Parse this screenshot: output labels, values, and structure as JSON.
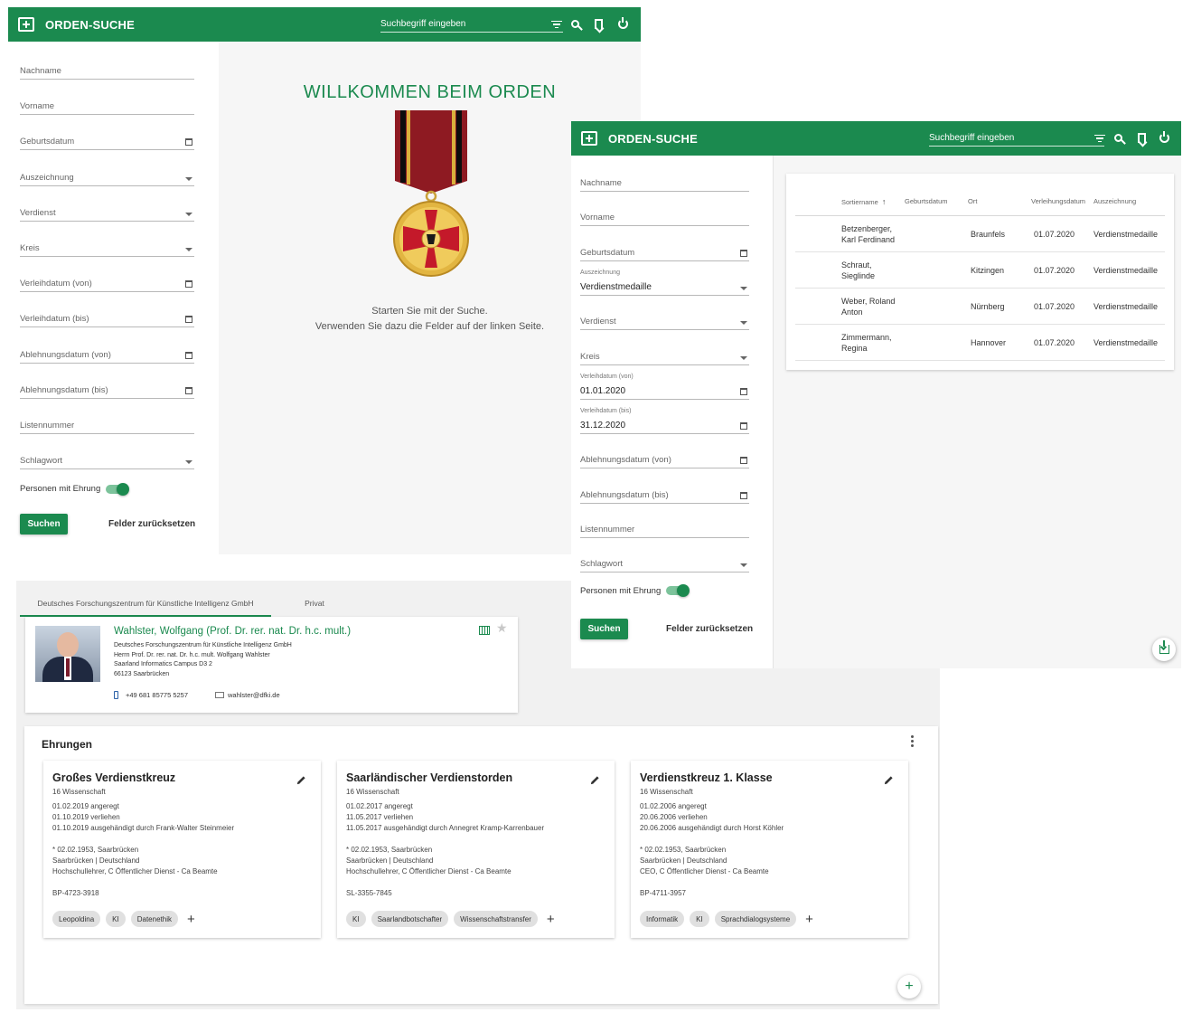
{
  "app": {
    "title": "ORDEN-SUCHE",
    "search_placeholder": "Suchbegriff eingeben"
  },
  "form1": {
    "fields": [
      {
        "label": "Nachname",
        "type": "text"
      },
      {
        "label": "Vorname",
        "type": "text"
      },
      {
        "label": "Geburtsdatum",
        "type": "date"
      },
      {
        "label": "Auszeichnung",
        "type": "select"
      },
      {
        "label": "Verdienst",
        "type": "select"
      },
      {
        "label": "Kreis",
        "type": "select"
      },
      {
        "label": "Verleihdatum (von)",
        "type": "date"
      },
      {
        "label": "Verleihdatum (bis)",
        "type": "date"
      },
      {
        "label": "Ablehnungsdatum (von)",
        "type": "date"
      },
      {
        "label": "Ablehnungsdatum (bis)",
        "type": "date"
      },
      {
        "label": "Listennummer",
        "type": "text"
      },
      {
        "label": "Schlagwort",
        "type": "select"
      }
    ],
    "toggle_label": "Personen mit Ehrung",
    "search_button": "Suchen",
    "reset_button": "Felder zurücksetzen"
  },
  "welcome": {
    "title": "WILLKOMMEN BEIM ORDEN",
    "line1": "Starten Sie mit der Suche.",
    "line2": "Verwenden Sie dazu die Felder auf der linken Seite."
  },
  "form2": {
    "fields": [
      {
        "label": "Nachname",
        "type": "text"
      },
      {
        "label": "Vorname",
        "type": "text"
      },
      {
        "label": "Geburtsdatum",
        "type": "date"
      },
      {
        "label": "Auszeichnung",
        "type": "select",
        "value": "Verdienstmedaille"
      },
      {
        "label": "Verdienst",
        "type": "select"
      },
      {
        "label": "Kreis",
        "type": "select"
      },
      {
        "label": "Verleihdatum (von)",
        "type": "date",
        "value": "01.01.2020"
      },
      {
        "label": "Verleihdatum (bis)",
        "type": "date",
        "value": "31.12.2020"
      },
      {
        "label": "Ablehnungsdatum (von)",
        "type": "date"
      },
      {
        "label": "Ablehnungsdatum (bis)",
        "type": "date"
      },
      {
        "label": "Listennummer",
        "type": "text"
      },
      {
        "label": "Schlagwort",
        "type": "select"
      }
    ],
    "toggle_label": "Personen mit Ehrung",
    "search_button": "Suchen",
    "reset_button": "Felder zurücksetzen"
  },
  "results": {
    "columns": [
      "Sortiername",
      "Geburtsdatum",
      "Ort",
      "Verleihungsdatum",
      "Auszeichnung"
    ],
    "sort_icon": "arrow-up-icon",
    "rows": [
      {
        "name1": "Betzenberger,",
        "name2": "Karl Ferdinand",
        "ort": "Braunfels",
        "datum": "01.07.2020",
        "auszeichnung": "Verdienstmedaille"
      },
      {
        "name1": "Schraut,",
        "name2": "Sieglinde",
        "ort": "Kitzingen",
        "datum": "01.07.2020",
        "auszeichnung": "Verdienstmedaille"
      },
      {
        "name1": "Weber, Roland",
        "name2": "Anton",
        "ort": "Nürnberg",
        "datum": "01.07.2020",
        "auszeichnung": "Verdienstmedaille"
      },
      {
        "name1": "Zimmermann,",
        "name2": "Regina",
        "ort": "Hannover",
        "datum": "01.07.2020",
        "auszeichnung": "Verdienstmedaille"
      }
    ]
  },
  "profile": {
    "tabs": [
      "Deutsches Forschungszentrum für Künstliche Intelligenz GmbH",
      "Privat"
    ],
    "name": "Wahlster, Wolfgang (Prof. Dr. rer. nat. Dr. h.c. mult.)",
    "address": [
      "Deutsches Forschungszentrum für Künstliche Intelligenz GmbH",
      "Herrn Prof. Dr. rer. nat. Dr. h.c. mult. Wolfgang Wahlster",
      "Saarland Informatics Campus D3 2",
      "66123 Saarbrücken"
    ],
    "phone": "+49 681 85775 5257",
    "email": "wahlster@dfki.de"
  },
  "ehrungen": {
    "title": "Ehrungen",
    "awards": [
      {
        "title": "Großes Verdienstkreuz",
        "lines": [
          "16 Wissenschaft",
          "",
          "01.02.2019 angeregt",
          "01.10.2019 verliehen",
          "01.10.2019 ausgehändigt durch Frank-Walter Steinmeier",
          "",
          "",
          "* 02.02.1953, Saarbrücken",
          "Saarbrücken | Deutschland",
          "Hochschullehrer, C Öffentlicher Dienst - Ca Beamte",
          "",
          "",
          "BP-4723-3918"
        ],
        "tags": [
          "Leopoldina",
          "KI",
          "Datenethik"
        ]
      },
      {
        "title": "Saarländischer Verdienstorden",
        "lines": [
          "16 Wissenschaft",
          "",
          "01.02.2017 angeregt",
          "11.05.2017 verliehen",
          "11.05.2017 ausgehändigt durch Annegret Kramp-Karrenbauer",
          "",
          "",
          "* 02.02.1953, Saarbrücken",
          "Saarbrücken | Deutschland",
          "Hochschullehrer, C Öffentlicher Dienst - Ca Beamte",
          "",
          "",
          "SL-3355-7845"
        ],
        "tags": [
          "KI",
          "Saarlandbotschafter",
          "Wissenschaftstransfer"
        ]
      },
      {
        "title": "Verdienstkreuz 1. Klasse",
        "lines": [
          "16 Wissenschaft",
          "",
          "01.02.2006 angeregt",
          "20.06.2006 verliehen",
          "20.06.2006 ausgehändigt durch Horst Köhler",
          "",
          "",
          "* 02.02.1953, Saarbrücken",
          "Saarbrücken | Deutschland",
          "CEO, C Öffentlicher Dienst - Ca Beamte",
          "",
          "",
          "BP-4711-3957"
        ],
        "tags": [
          "Informatik",
          "KI",
          "Sprachdialogsysteme"
        ]
      }
    ]
  },
  "colors": {
    "brand": "#1b8a4f"
  }
}
